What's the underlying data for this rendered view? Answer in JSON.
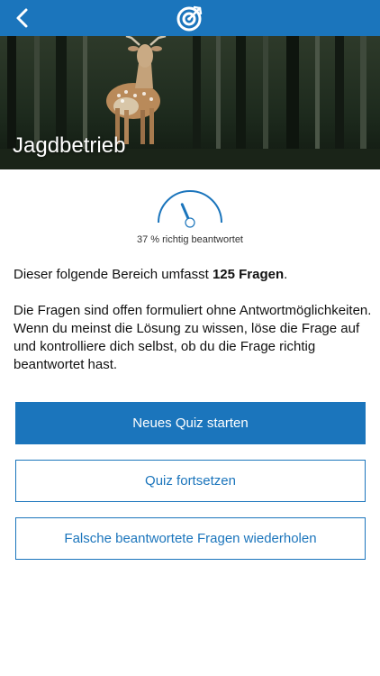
{
  "nav": {
    "back_icon": "chevron-left-icon",
    "logo_icon": "target-logo-icon",
    "color": "#1b75bc"
  },
  "hero": {
    "title": "Jagdbetrieb",
    "image": "fallow-deer-in-forest"
  },
  "progress": {
    "percent": 37,
    "caption": "37 % richtig beantwortet"
  },
  "intro": {
    "prefix": "Dieser folgende Bereich umfasst ",
    "count_label": "125 Fragen",
    "suffix": "."
  },
  "description": "Die Fragen sind offen formuliert ohne Antwortmöglichkeiten. Wenn du meinst die Lösung zu wissen, löse die Frage auf und kontrolliere dich selbst, ob du die Frage richtig beantwortet hast.",
  "buttons": {
    "start": "Neues Quiz starten",
    "continue": "Quiz fortsetzen",
    "repeat_wrong": "Falsche beantwortete Fragen wiederholen"
  }
}
